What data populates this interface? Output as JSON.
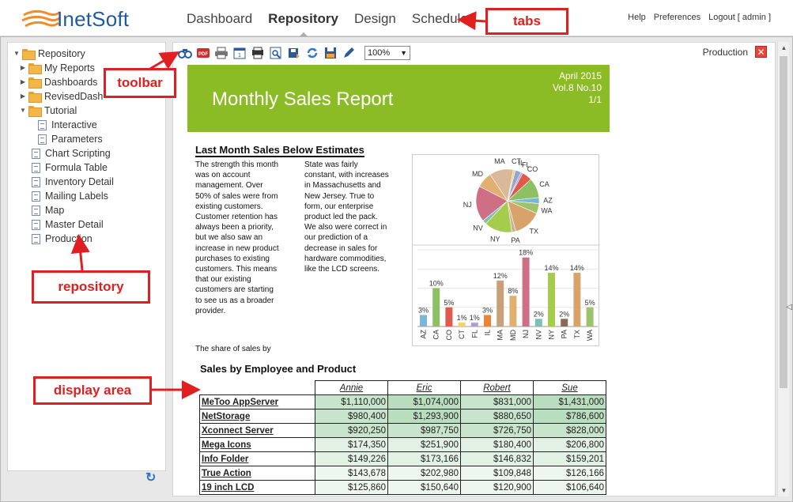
{
  "app": {
    "logo_text": "InetSoft"
  },
  "tabs": [
    {
      "label": "Dashboard"
    },
    {
      "label": "Repository"
    },
    {
      "label": "Design"
    },
    {
      "label": "Schedule"
    }
  ],
  "top_links": {
    "help": "Help",
    "preferences": "Preferences",
    "logout": "Logout [ admin ]"
  },
  "tree": {
    "root": "Repository",
    "items": [
      {
        "label": "My Reports"
      },
      {
        "label": "Dashboards"
      },
      {
        "label": "RevisedDash"
      },
      {
        "label": "Tutorial"
      },
      {
        "label": "Interactive"
      },
      {
        "label": "Parameters"
      },
      {
        "label": "Chart Scripting"
      },
      {
        "label": "Formula Table"
      },
      {
        "label": "Inventory Detail"
      },
      {
        "label": "Mailing Labels"
      },
      {
        "label": "Map"
      },
      {
        "label": "Master Detail"
      },
      {
        "label": "Production"
      }
    ]
  },
  "toolbar": {
    "zoom": "100%"
  },
  "viewer": {
    "report_name": "Production",
    "close": "✕"
  },
  "report": {
    "banner_title": "Monthly Sales Report",
    "date": "April 2015",
    "volume": "Vol.8 No.10",
    "page": "1/1",
    "heading": "Last Month Sales Below Estimates",
    "col1_lines": [
      "The strength this month",
      "was on account",
      "management. Over",
      "50% of sales were from",
      "existing customers.",
      "Customer retention has",
      "always been a priority,",
      "but we also saw an",
      "increase in new product",
      "purchases to existing",
      "customers. This means",
      "that our existing",
      "customers are starting",
      "to see us as a broader",
      "provider."
    ],
    "col2_lines": [
      "State was fairly",
      "constant, with increases",
      "in Massachusetts and",
      "New Jersey. True to",
      "form, our enterprise",
      "product led the pack.",
      "We also were correct in",
      "our prediction of a",
      "decrease in sales for",
      "hardware commodities,",
      "like the LCD screens."
    ],
    "share_text": "The share of sales by",
    "table_title": "Sales by Employee and Product",
    "table": {
      "headers": [
        "Annie",
        "Eric",
        "Robert",
        "Sue"
      ],
      "rows": [
        {
          "product": "MeToo AppServer",
          "values": [
            "$1,110,000",
            "$1,074,000",
            "$831,000",
            "$1,431,000"
          ]
        },
        {
          "product": "NetStorage",
          "values": [
            "$980,400",
            "$1,293,900",
            "$880,650",
            "$786,600"
          ]
        },
        {
          "product": "Xconnect Server",
          "values": [
            "$920,250",
            "$987,750",
            "$726,750",
            "$828,000"
          ]
        },
        {
          "product": "Mega Icons",
          "values": [
            "$174,350",
            "$251,900",
            "$180,400",
            "$206,800"
          ]
        },
        {
          "product": "Info Folder",
          "values": [
            "$149,226",
            "$173,166",
            "$146,832",
            "$159,201"
          ]
        },
        {
          "product": "True Action",
          "values": [
            "$143,678",
            "$202,980",
            "$109,848",
            "$126,166"
          ]
        },
        {
          "product": "19 inch LCD",
          "values": [
            "$125,860",
            "$150,640",
            "$120,900",
            "$106,640"
          ]
        }
      ]
    }
  },
  "chart_data": [
    {
      "type": "pie",
      "categories": [
        "IL",
        "FL",
        "CO",
        "CA",
        "AZ",
        "WA",
        "TX",
        "PA",
        "NY",
        "NV",
        "NJ",
        "MD",
        "MA",
        "CT"
      ],
      "values": [
        3,
        1,
        5,
        10,
        3,
        5,
        14,
        2,
        14,
        2,
        18,
        8,
        12,
        1
      ],
      "colors": [
        "#8fa6d6",
        "#b49ad6",
        "#e05a4b",
        "#8cc063",
        "#7ab6d8",
        "#9cc46a",
        "#d8a36a",
        "#c7b39a",
        "#a6cc4e",
        "#7bbfb6",
        "#cf6f86",
        "#e0b071",
        "#d9b99a",
        "#f2d06b"
      ]
    },
    {
      "type": "bar",
      "categories": [
        "AZ",
        "CA",
        "CO",
        "CT",
        "FL",
        "IL",
        "MA",
        "MD",
        "NJ",
        "NV",
        "NY",
        "PA",
        "TX",
        "WA"
      ],
      "values": [
        3,
        10,
        5,
        1,
        1,
        3,
        12,
        8,
        18,
        2,
        14,
        2,
        14,
        5
      ],
      "labels": [
        "3%",
        "10%",
        "5%",
        "1%",
        "1%",
        "3%",
        "12%",
        "8%",
        "18%",
        "2%",
        "14%",
        "2%",
        "14%",
        "5%"
      ],
      "ylim": [
        0,
        20
      ],
      "colors": [
        "#7ab6d8",
        "#8cc063",
        "#e05a4b",
        "#f2d06b",
        "#b49ad6",
        "#e8843a",
        "#c8a17a",
        "#e0b071",
        "#cf6f86",
        "#7bbfb6",
        "#a6cc4e",
        "#8a6a5a",
        "#d8a36a",
        "#9cc46a"
      ]
    }
  ],
  "callouts": {
    "tabs": "tabs",
    "toolbar": "toolbar",
    "repository": "repository",
    "display_area": "display area"
  },
  "accent_colors": {
    "banner": "#8cbc25",
    "callout": "#e02020",
    "logo": "#1f5aa6"
  }
}
